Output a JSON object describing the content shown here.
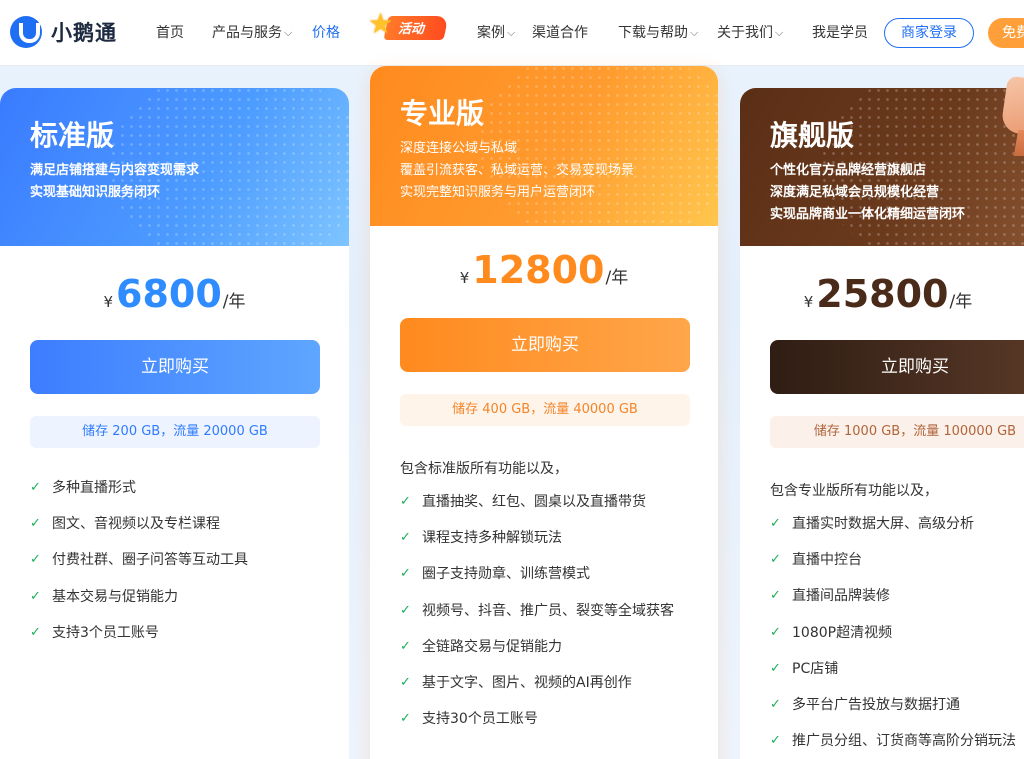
{
  "header": {
    "logo_text": "小鹅通",
    "nav": {
      "home": "首页",
      "products": "产品与服务",
      "pricing": "价格",
      "activity": "活动",
      "cases": "案例",
      "channel": "渠道合作",
      "download": "下载与帮助",
      "about": "关于我们",
      "student": "我是学员"
    },
    "login_button": "商家登录",
    "free_button": "免费"
  },
  "plans": {
    "standard": {
      "title": "标准版",
      "desc": [
        "满足店铺搭建与内容变现需求",
        "实现基础知识服务闭环"
      ],
      "currency": "¥",
      "price": "6800",
      "unit": "/年",
      "buy": "立即购买",
      "storage": "储存 200 GB，流量 20000 GB",
      "features": [
        "多种直播形式",
        "图文、音视频以及专栏课程",
        "付费社群、圈子问答等互动工具",
        "基本交易与促销能力",
        "支持3个员工账号"
      ]
    },
    "pro": {
      "title": "专业版",
      "desc": [
        "深度连接公域与私域",
        "覆盖引流获客、私域运营、交易变现场景",
        "实现完整知识服务与用户运营闭环"
      ],
      "currency": "¥",
      "price": "12800",
      "unit": "/年",
      "buy": "立即购买",
      "storage": "储存 400 GB，流量 40000 GB",
      "intro": "包含标准版所有功能以及，",
      "features": [
        "直播抽奖、红包、圆桌以及直播带货",
        "课程支持多种解锁玩法",
        "圈子支持勋章、训练营模式",
        "视频号、抖音、推广员、裂变等全域获客",
        "全链路交易与促销能力",
        "基于文字、图片、视频的AI再创作",
        "支持30个员工账号"
      ]
    },
    "flagship": {
      "title": "旗舰版",
      "desc": [
        "个性化官方品牌经营旗舰店",
        "深度满足私域会员规模化经营",
        "实现品牌商业一体化精细运营闭环"
      ],
      "currency": "¥",
      "price": "25800",
      "unit": "/年",
      "buy": "立即购买",
      "storage": "储存 1000 GB，流量 100000 GB",
      "intro": "包含专业版所有功能以及，",
      "features": [
        "直播实时数据大屏、高级分析",
        "直播中控台",
        "直播间品牌装修",
        "1080P超清视频",
        "PC店铺",
        "多平台广告投放与数据打通",
        "推广员分组、订货商等高阶分销玩法"
      ]
    }
  },
  "colors": {
    "brand_blue": "#1f6ff5",
    "standard_accent": "#2f8cff",
    "pro_accent": "#ff8a1e",
    "flagship_accent": "#4a2a18",
    "check_green": "#1aae5a"
  }
}
